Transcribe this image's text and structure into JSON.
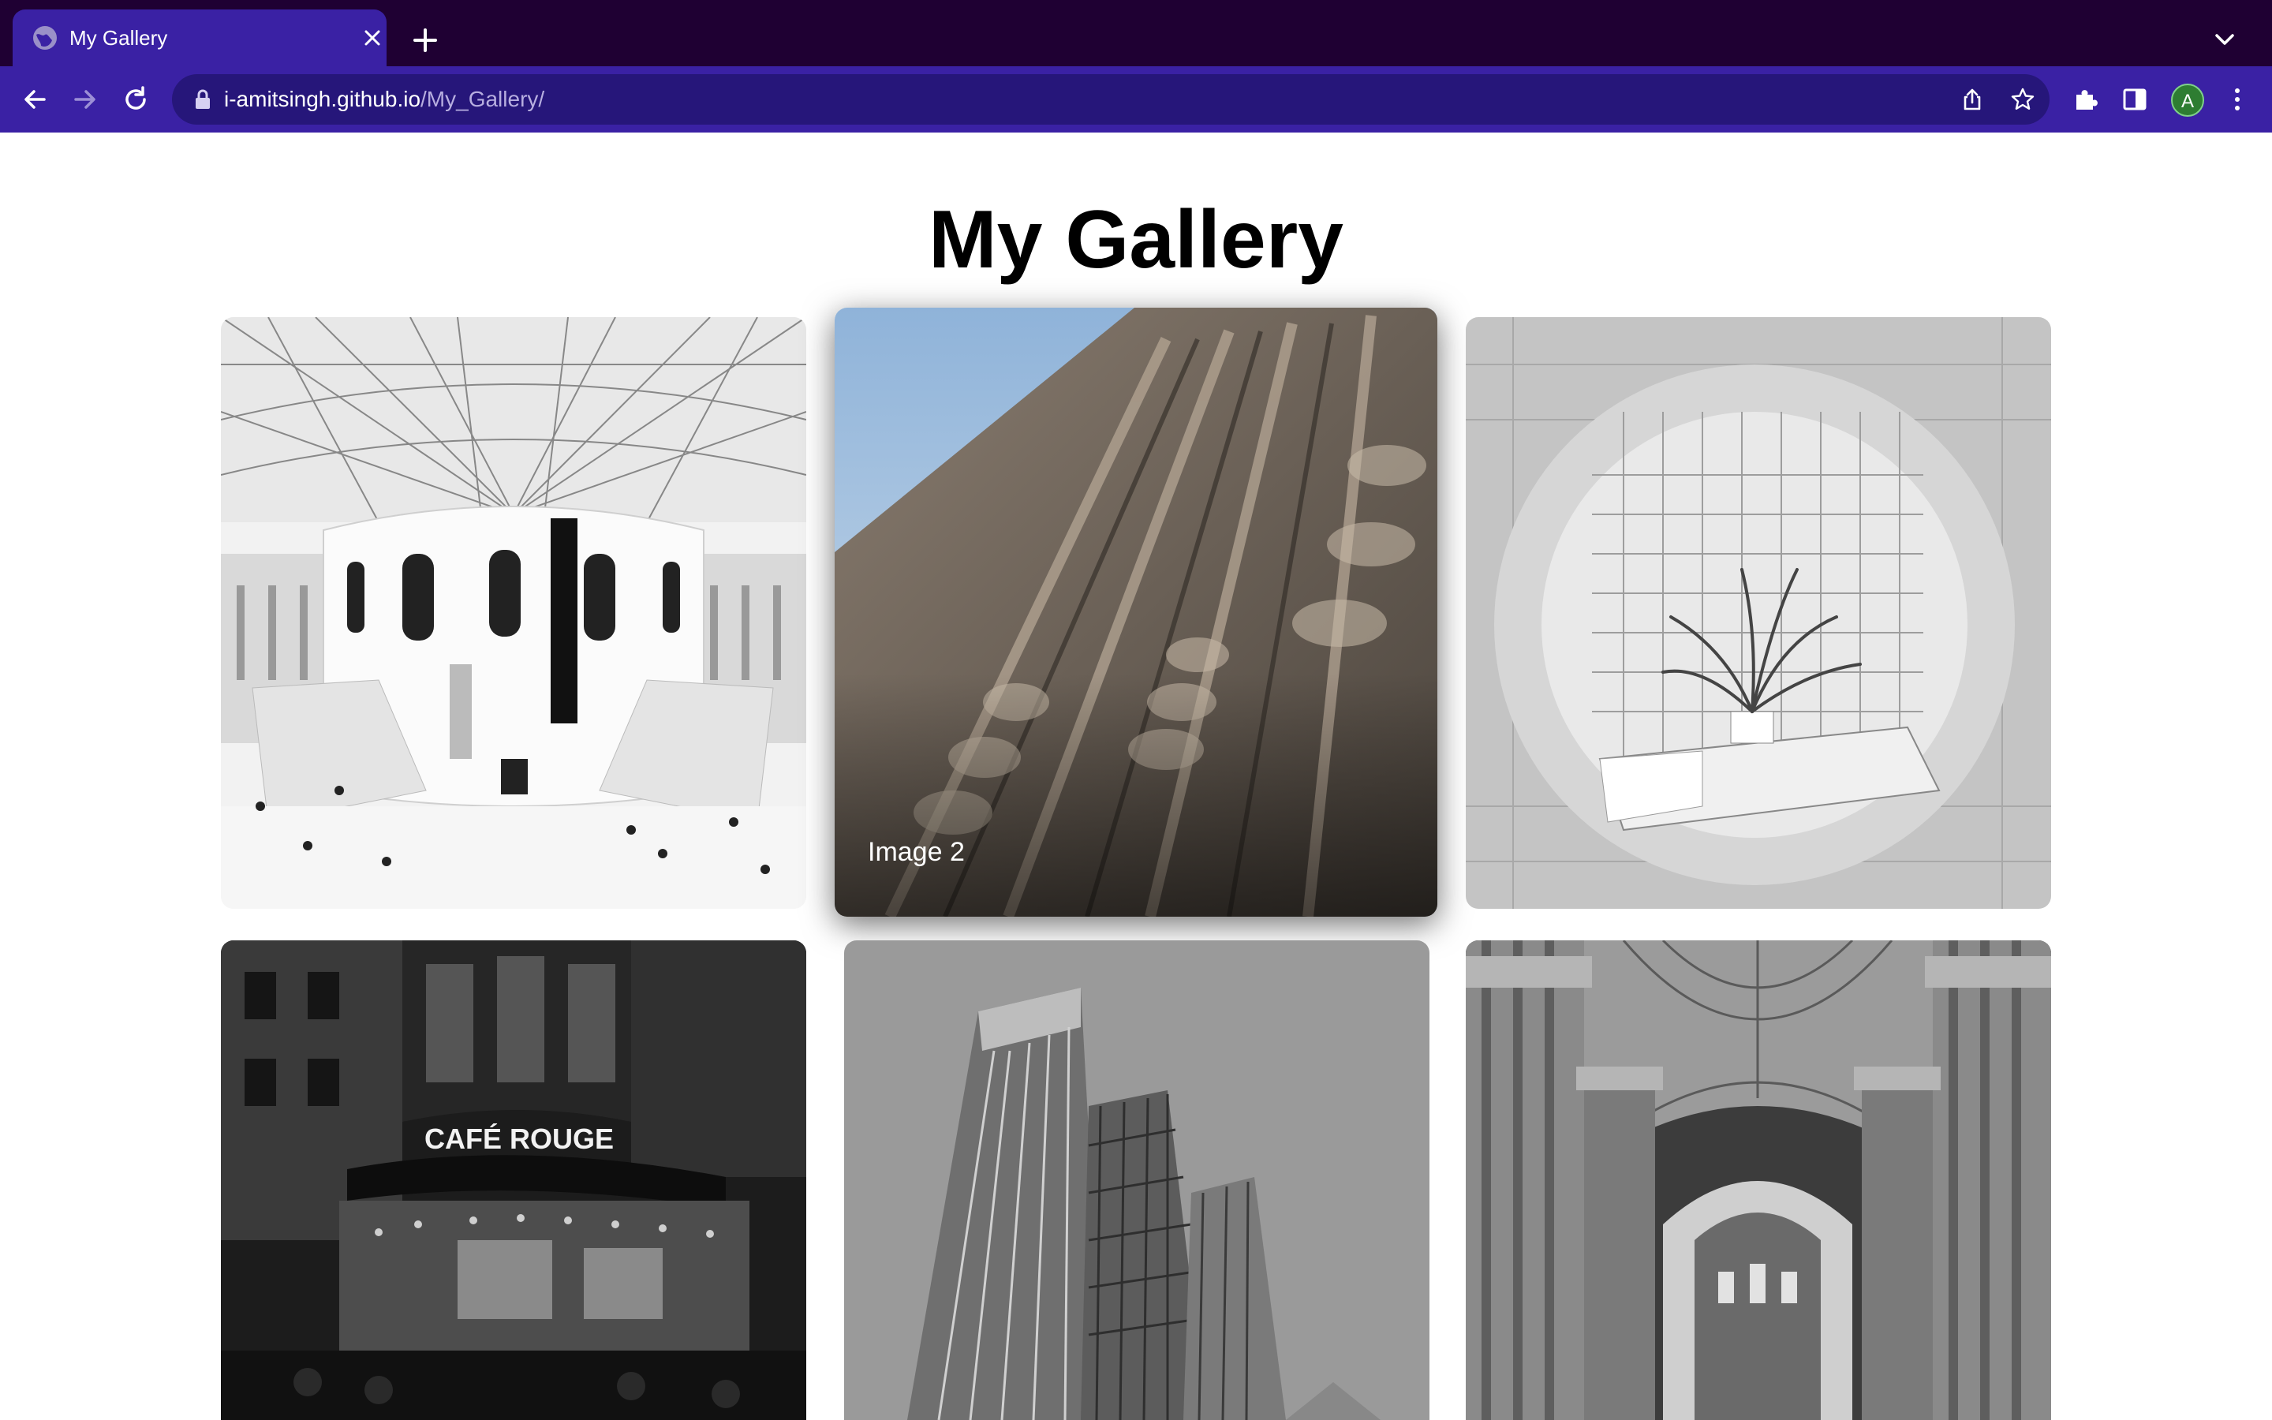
{
  "browser": {
    "tab_title": "My Gallery",
    "url_host": "i-amitsingh.github.io",
    "url_path": "/My_Gallery/",
    "profile_initial": "A",
    "colors": {
      "tabstrip": "#1f0033",
      "toolbar": "#3a21a4",
      "omnibox": "#26167a"
    }
  },
  "page": {
    "title": "My Gallery",
    "gallery": {
      "items": [
        {
          "caption": "",
          "subject": "domed-atrium-rotunda"
        },
        {
          "caption": "Image 2",
          "subject": "ornate-cathedral-facade",
          "hovered": true
        },
        {
          "caption": "",
          "subject": "potted-palm-tiled-room"
        },
        {
          "caption": "",
          "subject": "cafe-storefront-night",
          "sign_text": "CAFÉ ROUGE"
        },
        {
          "caption": "",
          "subject": "glass-tower-building"
        },
        {
          "caption": "",
          "subject": "cathedral-interior-columns"
        }
      ]
    }
  }
}
